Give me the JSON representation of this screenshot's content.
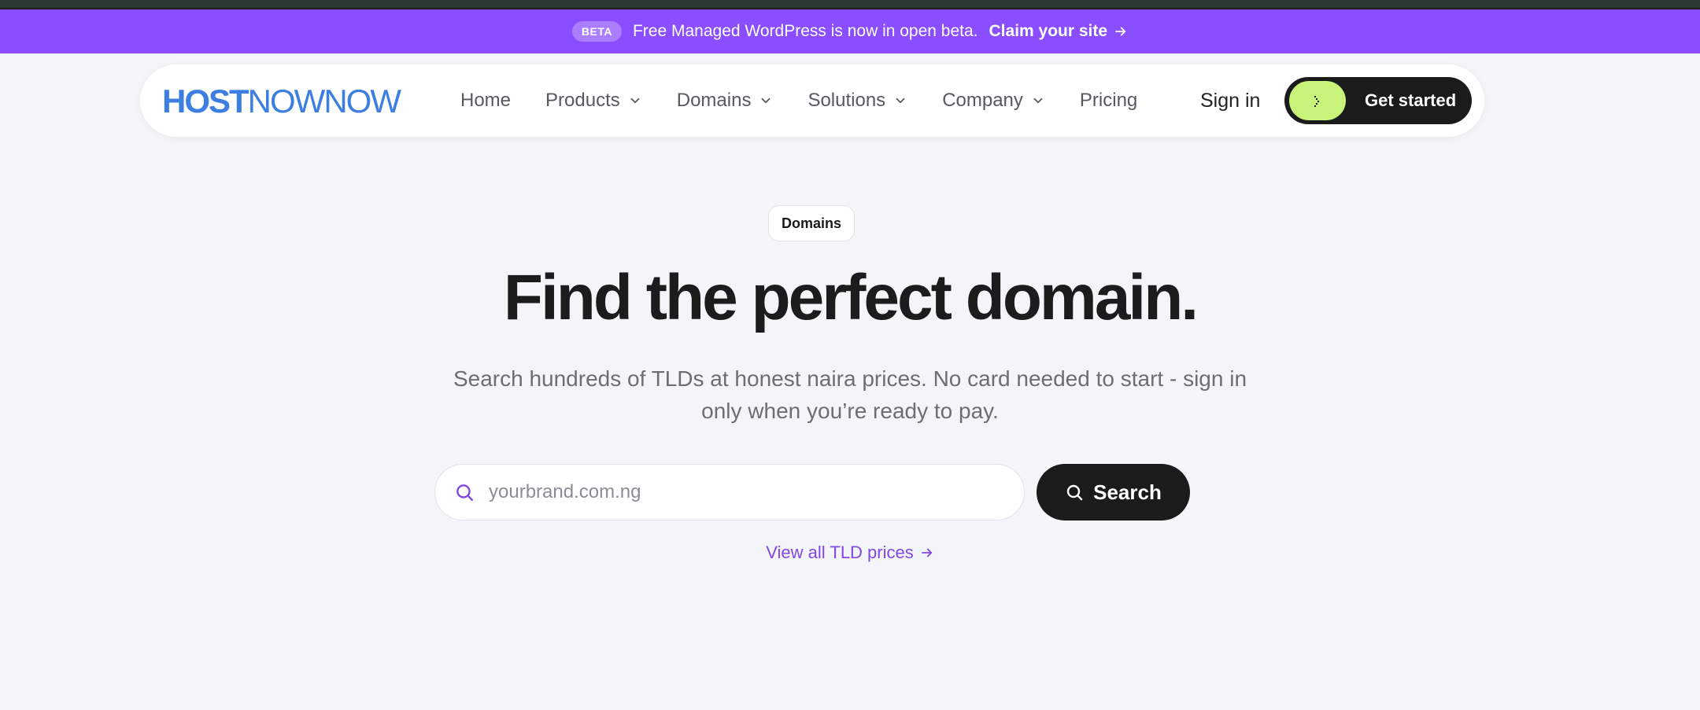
{
  "promo": {
    "badge": "BETA",
    "message": "Free Managed WordPress is now in open beta.",
    "link_label": "Claim your site"
  },
  "nav": {
    "logo": {
      "bold": "HOST",
      "regular": "NOWNOW"
    },
    "items": [
      {
        "label": "Home",
        "has_dropdown": false
      },
      {
        "label": "Products",
        "has_dropdown": true
      },
      {
        "label": "Domains",
        "has_dropdown": true
      },
      {
        "label": "Solutions",
        "has_dropdown": true
      },
      {
        "label": "Company",
        "has_dropdown": true
      },
      {
        "label": "Pricing",
        "has_dropdown": false
      }
    ],
    "sign_in": "Sign in",
    "get_started": "Get started"
  },
  "hero": {
    "eyebrow": "Domains",
    "title": "Find the perfect domain.",
    "subtitle": "Search hundreds of TLDs at honest naira prices. No card needed to start - sign in only when you’re ready to pay.",
    "search_placeholder": "yourbrand.com.ng",
    "search_button": "Search",
    "tld_link": "View all TLD prices"
  },
  "colors": {
    "promo_bg": "#8a4dff",
    "accent_purple": "#8246e6",
    "logo_blue": "#3d7fe0",
    "cta_dark": "#1b1b1b",
    "cta_pill": "#c8f27a",
    "page_bg": "#f4f5f8"
  }
}
